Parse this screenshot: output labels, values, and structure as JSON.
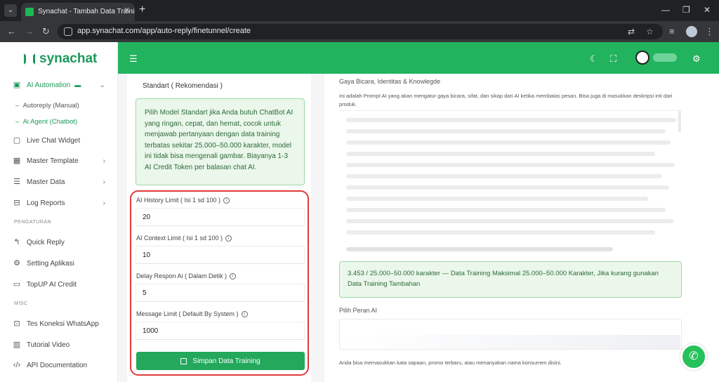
{
  "browser": {
    "tab_title": "Synachat - Tambah Data Training F",
    "url": "app.synachat.com/app/auto-reply/finetunnel/create"
  },
  "brand": {
    "name": "synachat",
    "color": "#1a9a5a"
  },
  "sidebar": {
    "ai_automation": "AI Automation",
    "autoreply_manual": "Autoreply (Manual)",
    "ai_agent": "Ai Agent (Chatbot)",
    "live_chat": "Live Chat Widget",
    "master_template": "Master Template",
    "master_data": "Master Data",
    "log_reports": "Log Reports",
    "section_pengaturan": "PENGATURAN",
    "quick_reply": "Quick Reply",
    "setting_aplikasi": "Setting Aplikasi",
    "topup": "TopUP AI Credit",
    "section_misc": "MISC",
    "tes_koneksi": "Tes Koneksi WhatsApp",
    "tutorial": "Tutorial Video",
    "api_doc": "API Documentation"
  },
  "left_panel": {
    "model_selected": "Standart ( Rekomendasi )",
    "model_info": "Pilih Model Standart jika Anda butuh ChatBot AI yang ringan, cepat, dan hemat, cocok untuk menjawab pertanyaan dengan data training terbatas sekitar 25.000–50.000 karakter, model ini tidak bisa mengenali gambar. Biayanya 1-3 AI Credit Token per balasan chat AI.",
    "history_label": "AI History Limit ( Isi 1 sd 100 )",
    "history_value": "20",
    "context_label": "AI Context Limit ( Isi 1 sd 100 )",
    "context_value": "10",
    "delay_label": "Delay Respon Ai ( Dalam Detik )",
    "delay_value": "5",
    "message_label": "Message Limit ( Default By System )",
    "message_value": "1000",
    "save_button": "Simpan Data Training"
  },
  "right_panel": {
    "style_label": "Gaya Bicara, Identitas & Knowlegde",
    "style_desc": "Ini adalah Prompt AI yang akan mengatur gaya bicara, sifat, dan sikap dari AI ketika membalas pesan. Bisa juga di masukkan deskripsi inti dari produk.",
    "char_count": "3.453 / 25.000–50.000 karakter — Data Training Maksimal 25.000–50.000 Karakter, Jika kurang gunakan Data Training Tambahan",
    "role_label": "Pilih Peran AI",
    "role_hint": "Anda bisa memasukkan kata sapaan, promo terbaru, atau menanyakan nama konsumen disini."
  },
  "colors": {
    "topbar": "#22b35e",
    "accent": "#23a85c",
    "highlight_frame": "#e03a3a"
  }
}
